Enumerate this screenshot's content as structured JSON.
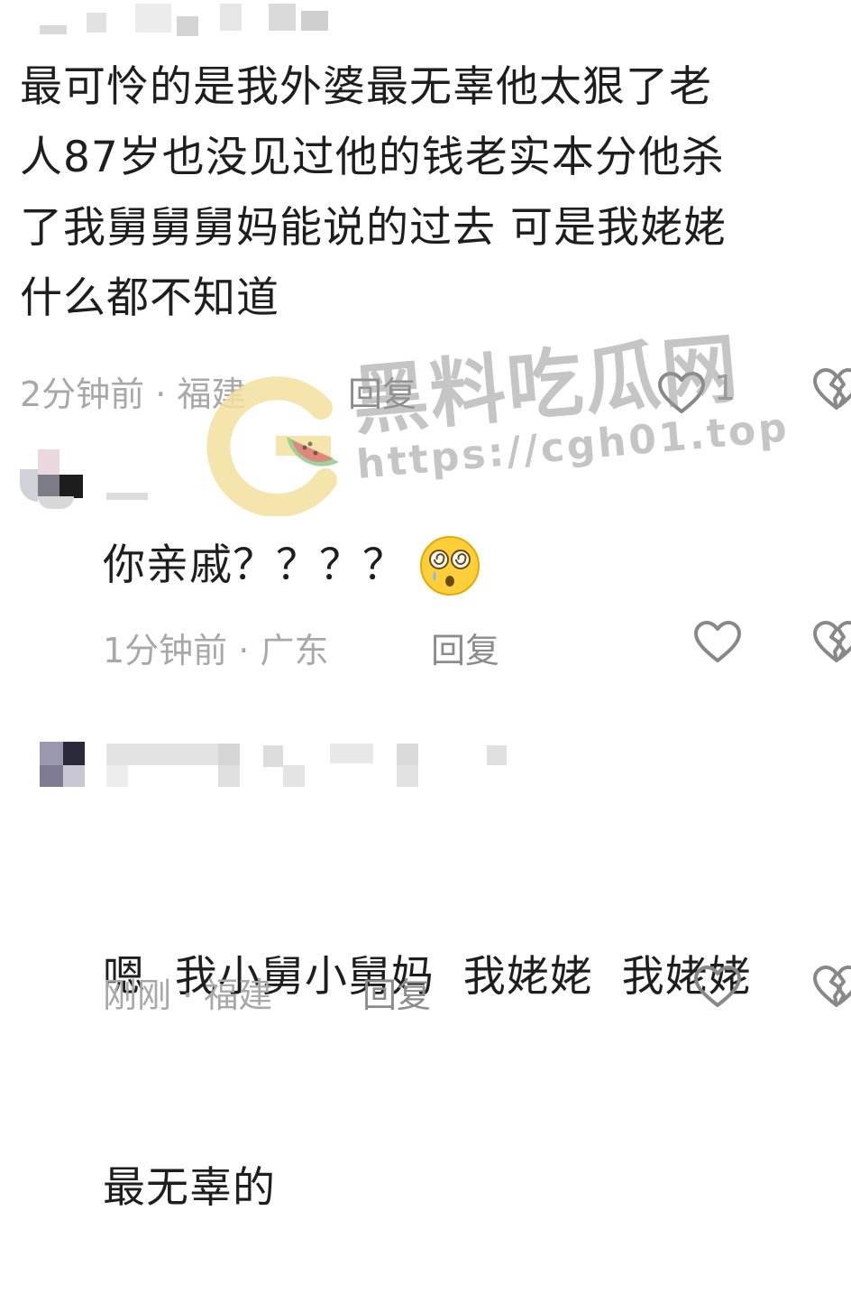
{
  "comments": [
    {
      "text_lines": [
        "最可怜的是我外婆最无辜他太狠了老",
        "人87岁也没见过他的钱老实本分他杀",
        "了我舅舅舅妈能说的过去 可是我姥姥",
        "什么都不知道"
      ],
      "time": "2分钟前",
      "location": "福建",
      "reply_label": "回复",
      "like_count": "1"
    },
    {
      "text": "你亲戚？？？？",
      "emoji": "😳",
      "time": "1分钟前",
      "location": "广东",
      "reply_label": "回复"
    },
    {
      "text_lines": [
        "嗯  我小舅小舅妈  我姥姥  我姥姥",
        "最无辜的"
      ],
      "time": "刚刚",
      "location": "福建",
      "reply_label": "回复"
    }
  ],
  "separator": "·",
  "watermark": {
    "title": "黑料吃瓜网",
    "url": "https://cgh01.top"
  },
  "colors": {
    "text": "#1e1e1e",
    "meta": "#a8a8a8",
    "watermark_yellow": "#f3df9e",
    "watermark_green": "#8fcb8a",
    "watermark_red": "#e97b7b"
  },
  "icons": [
    "heart-icon",
    "dislike-icon",
    "dizzy-face-emoji"
  ]
}
